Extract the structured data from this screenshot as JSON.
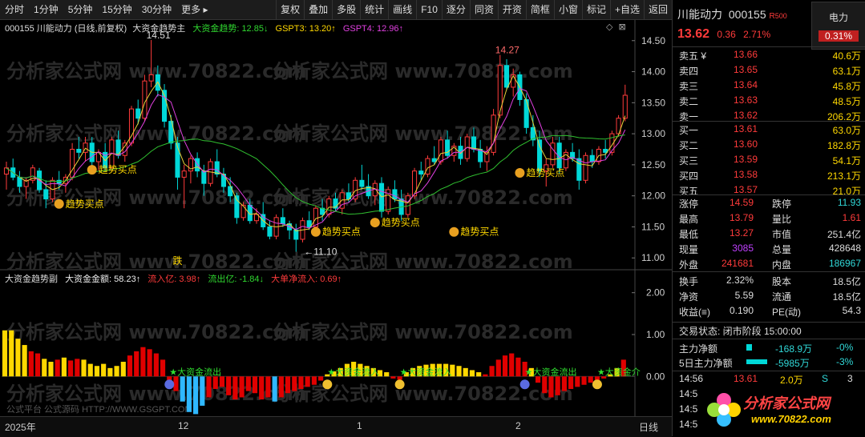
{
  "toolbar": {
    "left": [
      "分时",
      "1分钟",
      "5分钟",
      "15分钟",
      "30分钟",
      "更多 ▸"
    ],
    "right": [
      "复权",
      "叠加",
      "多股",
      "统计",
      "画线",
      "F10",
      "逐分",
      "同资",
      "开资",
      "简框",
      "小窗",
      "标记",
      "+自选",
      "返回"
    ]
  },
  "main_legend": {
    "prefix": "000155 川能动力 (日线,前复权)",
    "indicator": "大资金趋势主",
    "v1": "大资金趋势: 12.85↓",
    "v2": "GSPT3: 13.20↑",
    "v3": "GSPT4: 12.96↑"
  },
  "sub_legend": {
    "indicator": "大资金趋势副",
    "v1": "大资金金额: 58.23↑",
    "v2": "流入亿: 3.98↑",
    "v3": "流出亿: -1.84↓",
    "v4": "大单净流入: 0.69↑"
  },
  "main_axis": [
    "14.50",
    "14.00",
    "13.50",
    "13.00",
    "12.50",
    "12.00",
    "11.50",
    "11.00"
  ],
  "sub_axis": [
    "2.00",
    "1.00",
    "0.00",
    "-1.00"
  ],
  "annotations": {
    "high1": "14.51",
    "high2": "14.27",
    "low": "11.10",
    "fall": "跌",
    "buy": "趋势买点",
    "inflow": "★大资金流入",
    "outflow": "★大资金流出",
    "inflow_cut": "★大资金介"
  },
  "watermark": "分析家公式网 www.70822.com",
  "watermark2": "公式平台 公式源码 HTTP://WWW.GSGPT.COM",
  "x_labels": [
    "2025年",
    "12",
    "1",
    "2"
  ],
  "period_label": "日线",
  "colors": {
    "up": "#ff3b3b",
    "down": "#00d8d8",
    "yellow": "#ffd800",
    "red_bar": "#e00000",
    "cyan_bar": "#2fb8ff",
    "ma_yellow": "#e8d23a",
    "ma_pink": "#e040e0",
    "ma_green": "#30c030"
  },
  "chart_data": {
    "type": "candlestick",
    "ylim": [
      10.9,
      14.6
    ],
    "candles": [
      [
        12.35,
        12.55,
        12.1,
        12.45
      ],
      [
        12.45,
        12.6,
        12.25,
        12.3
      ],
      [
        12.3,
        12.4,
        12.05,
        12.15
      ],
      [
        12.15,
        12.3,
        11.95,
        12.25
      ],
      [
        12.25,
        12.5,
        12.2,
        12.45
      ],
      [
        12.4,
        12.45,
        12.05,
        12.1
      ],
      [
        12.1,
        12.25,
        11.8,
        11.95
      ],
      [
        11.95,
        12.3,
        11.9,
        12.25
      ],
      [
        12.25,
        12.4,
        12.1,
        12.2
      ],
      [
        12.2,
        12.35,
        12.05,
        12.3
      ],
      [
        12.3,
        12.85,
        12.25,
        12.75
      ],
      [
        12.75,
        12.95,
        12.6,
        12.7
      ],
      [
        12.7,
        12.95,
        12.55,
        12.85
      ],
      [
        12.85,
        12.95,
        12.45,
        12.55
      ],
      [
        12.55,
        12.75,
        12.4,
        12.7
      ],
      [
        12.7,
        12.85,
        12.4,
        12.45
      ],
      [
        12.45,
        12.95,
        12.4,
        12.9
      ],
      [
        12.9,
        13.05,
        12.6,
        12.65
      ],
      [
        12.65,
        12.9,
        12.55,
        12.85
      ],
      [
        12.85,
        13.45,
        12.8,
        13.4
      ],
      [
        13.4,
        13.55,
        13.15,
        13.25
      ],
      [
        13.25,
        13.95,
        13.2,
        13.85
      ],
      [
        13.85,
        14.51,
        13.75,
        13.95
      ],
      [
        13.95,
        14.1,
        13.6,
        13.7
      ],
      [
        13.7,
        13.8,
        13.1,
        13.2
      ],
      [
        13.2,
        13.3,
        12.75,
        12.85
      ],
      [
        12.85,
        12.95,
        12.1,
        12.3
      ],
      [
        12.3,
        12.5,
        11.8,
        12.4
      ],
      [
        12.4,
        12.65,
        12.2,
        12.6
      ],
      [
        12.6,
        12.7,
        12.3,
        12.4
      ],
      [
        12.4,
        12.5,
        12.0,
        12.2
      ],
      [
        12.2,
        12.6,
        12.15,
        12.55
      ],
      [
        12.55,
        12.75,
        12.3,
        12.35
      ],
      [
        12.35,
        12.45,
        12.05,
        12.15
      ],
      [
        12.15,
        12.3,
        11.9,
        12.0
      ],
      [
        12.0,
        12.05,
        11.55,
        11.65
      ],
      [
        11.65,
        11.9,
        11.6,
        11.85
      ],
      [
        11.85,
        11.95,
        11.55,
        11.6
      ],
      [
        11.6,
        11.8,
        11.55,
        11.7
      ],
      [
        11.7,
        11.9,
        11.45,
        11.5
      ],
      [
        11.5,
        11.6,
        11.3,
        11.35
      ],
      [
        11.35,
        11.7,
        11.3,
        11.65
      ],
      [
        11.65,
        11.8,
        11.5,
        11.55
      ],
      [
        11.55,
        11.6,
        11.3,
        11.45
      ],
      [
        11.45,
        11.55,
        11.1,
        11.3
      ],
      [
        11.3,
        11.65,
        11.25,
        11.6
      ],
      [
        11.6,
        11.75,
        11.45,
        11.5
      ],
      [
        11.5,
        11.85,
        11.45,
        11.8
      ],
      [
        11.8,
        11.95,
        11.6,
        11.7
      ],
      [
        11.7,
        12.0,
        11.65,
        11.95
      ],
      [
        11.95,
        12.05,
        11.75,
        11.8
      ],
      [
        11.8,
        12.1,
        11.7,
        12.05
      ],
      [
        12.05,
        12.2,
        11.9,
        11.95
      ],
      [
        11.95,
        12.3,
        11.9,
        12.25
      ],
      [
        12.25,
        12.5,
        12.1,
        12.15
      ],
      [
        12.15,
        12.35,
        11.95,
        12.0
      ],
      [
        12.0,
        12.25,
        11.85,
        12.2
      ],
      [
        12.2,
        12.3,
        11.65,
        11.75
      ],
      [
        11.75,
        12.15,
        11.7,
        12.1
      ],
      [
        12.1,
        12.25,
        11.9,
        11.95
      ],
      [
        11.95,
        12.1,
        11.6,
        11.7
      ],
      [
        11.7,
        12.05,
        11.65,
        12.0
      ],
      [
        12.0,
        12.45,
        11.95,
        12.4
      ],
      [
        12.4,
        12.55,
        12.25,
        12.35
      ],
      [
        12.35,
        12.65,
        12.3,
        12.6
      ],
      [
        12.6,
        12.8,
        12.5,
        12.55
      ],
      [
        12.55,
        12.95,
        12.5,
        12.9
      ],
      [
        12.9,
        13.05,
        12.6,
        12.65
      ],
      [
        12.65,
        12.85,
        12.55,
        12.8
      ],
      [
        12.8,
        12.95,
        12.5,
        12.6
      ],
      [
        12.6,
        13.0,
        12.55,
        12.95
      ],
      [
        12.95,
        13.1,
        12.7,
        12.75
      ],
      [
        12.75,
        12.9,
        12.45,
        12.55
      ],
      [
        12.55,
        12.8,
        12.4,
        12.7
      ],
      [
        12.7,
        13.4,
        12.65,
        13.3
      ],
      [
        13.3,
        14.27,
        13.25,
        14.1
      ],
      [
        14.1,
        14.2,
        13.7,
        13.75
      ],
      [
        13.75,
        14.05,
        13.6,
        13.95
      ],
      [
        13.95,
        14.0,
        13.45,
        13.55
      ],
      [
        13.55,
        13.65,
        13.0,
        13.1
      ],
      [
        13.1,
        13.3,
        12.8,
        12.9
      ],
      [
        12.9,
        13.05,
        12.3,
        12.4
      ],
      [
        12.4,
        12.6,
        12.15,
        12.5
      ],
      [
        12.5,
        12.95,
        12.45,
        12.85
      ],
      [
        12.85,
        12.95,
        12.35,
        12.45
      ],
      [
        12.45,
        12.75,
        12.4,
        12.7
      ],
      [
        12.7,
        12.85,
        12.55,
        12.6
      ],
      [
        12.6,
        12.75,
        12.1,
        12.25
      ],
      [
        12.25,
        12.7,
        12.2,
        12.65
      ],
      [
        12.65,
        12.75,
        12.45,
        12.55
      ],
      [
        12.55,
        12.8,
        12.5,
        12.75
      ],
      [
        12.75,
        12.9,
        12.6,
        12.7
      ],
      [
        12.7,
        13.05,
        12.65,
        13.0
      ],
      [
        13.0,
        13.3,
        12.95,
        13.25
      ],
      [
        13.25,
        13.79,
        13.2,
        13.62
      ]
    ],
    "sub_values": [
      1.1,
      1.1,
      0.9,
      0.75,
      0.6,
      0.55,
      0.42,
      0.35,
      0.4,
      0.45,
      0.38,
      0.42,
      0.4,
      0.3,
      0.25,
      0.3,
      0.2,
      0.25,
      0.35,
      0.5,
      0.6,
      0.7,
      0.65,
      0.55,
      0.4,
      -0.15,
      -0.35,
      -0.6,
      -0.85,
      -0.9,
      -0.7,
      -0.5,
      -0.3,
      -0.25,
      -0.45,
      -0.55,
      -0.5,
      -0.35,
      -0.4,
      -0.55,
      -0.5,
      -0.6,
      -0.5,
      -0.4,
      -0.35,
      -0.3,
      -0.25,
      -0.2,
      -0.1,
      0.05,
      0.12,
      0.2,
      0.3,
      0.35,
      0.3,
      0.25,
      0.2,
      0.15,
      0.1,
      -0.05,
      -0.08,
      0.1,
      0.2,
      0.25,
      0.28,
      0.3,
      0.3,
      0.3,
      0.28,
      0.25,
      0.2,
      0.15,
      0.1,
      0.05,
      0.25,
      0.4,
      0.5,
      0.55,
      0.45,
      0.35,
      0.2,
      -0.15,
      -0.4,
      -0.5,
      -0.45,
      -0.35,
      -0.3,
      -0.25,
      -0.2,
      -0.15,
      -0.1,
      -0.05,
      0.05,
      0.2,
      0.4
    ]
  },
  "side": {
    "stock_name": "川能动力",
    "stock_code": "000155",
    "badge": "R",
    "badge_num": "500",
    "sector": "电力",
    "sector_chg": "0.31%",
    "price": "13.62",
    "change": "0.36",
    "change_pct": "2.71%",
    "asks": [
      [
        "卖五 ¥",
        "13.66",
        "40.6万"
      ],
      [
        "卖四",
        "13.65",
        "63.1万"
      ],
      [
        "卖三",
        "13.64",
        "45.8万"
      ],
      [
        "卖二",
        "13.63",
        "48.5万"
      ],
      [
        "卖一",
        "13.62",
        "206.2万"
      ]
    ],
    "bids": [
      [
        "买一",
        "13.61",
        "63.0万"
      ],
      [
        "买二",
        "13.60",
        "182.8万"
      ],
      [
        "买三",
        "13.59",
        "54.1万"
      ],
      [
        "买四",
        "13.58",
        "213.1万"
      ],
      [
        "买五",
        "13.57",
        "21.0万"
      ]
    ],
    "stats": [
      [
        "涨停",
        "14.59",
        "跌停",
        "11.93"
      ],
      [
        "最高",
        "13.79",
        "量比",
        "1.61"
      ],
      [
        "最低",
        "13.27",
        "市值",
        "251.4亿"
      ],
      [
        "现量",
        "3085",
        "总量",
        "428648"
      ],
      [
        "外盘",
        "241681",
        "内盘",
        "186967"
      ]
    ],
    "stats2": [
      [
        "换手",
        "2.32%",
        "股本",
        "18.5亿"
      ],
      [
        "净资",
        "5.59",
        "流通",
        "18.5亿"
      ],
      [
        "收益(≡)",
        "0.190",
        "PE(动)",
        "54.3"
      ]
    ],
    "trade_status": "交易状态: 闭市阶段 15:00:00",
    "main_net": [
      "主力净额",
      "-168.9万",
      "-0%"
    ],
    "main_net5": [
      "5日主力净额",
      "-5985万",
      "-3%"
    ],
    "ticks": [
      [
        "14:56",
        "13.61",
        "2.0万",
        "S",
        "3"
      ],
      [
        "14:5",
        "",
        "",
        "",
        ""
      ],
      [
        "14:5",
        "",
        "",
        "",
        ""
      ],
      [
        "14:5",
        "",
        "",
        "",
        ""
      ]
    ],
    "brand": "分析家公式网",
    "brand_url": "www.70822.com"
  }
}
